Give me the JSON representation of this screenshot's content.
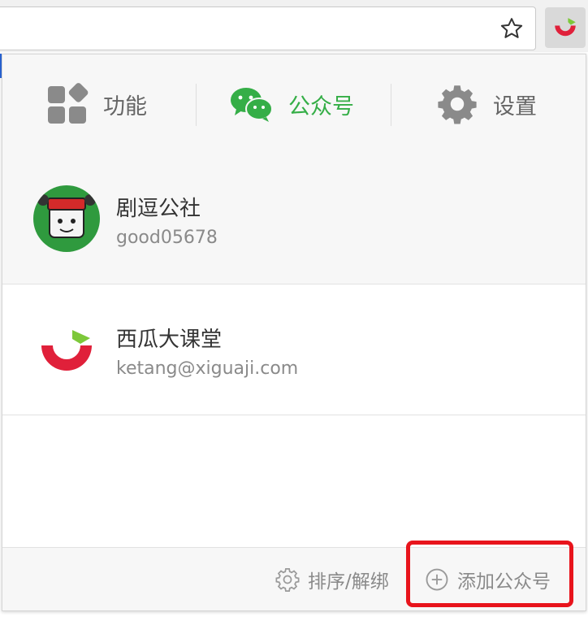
{
  "browser": {
    "bookmark_icon": "star-icon",
    "extension_icon": "xiguaji-logo-icon"
  },
  "tabs": [
    {
      "label": "功能",
      "icon": "grid-icon",
      "active": false
    },
    {
      "label": "公众号",
      "icon": "wechat-icon",
      "active": true
    },
    {
      "label": "设置",
      "icon": "gear-icon",
      "active": false
    }
  ],
  "accounts": [
    {
      "name": "剧逗公社",
      "id": "good05678",
      "avatar": "avatar-image"
    },
    {
      "name": "西瓜大课堂",
      "id": "ketang@xiguaji.com",
      "avatar": "xiguaji-logo"
    }
  ],
  "footer": {
    "sort_label": "排序/解绑",
    "add_label": "添加公众号"
  },
  "colors": {
    "accent_green": "#35ae47",
    "highlight_red": "#e8141c",
    "logo_red": "#e0203a"
  }
}
